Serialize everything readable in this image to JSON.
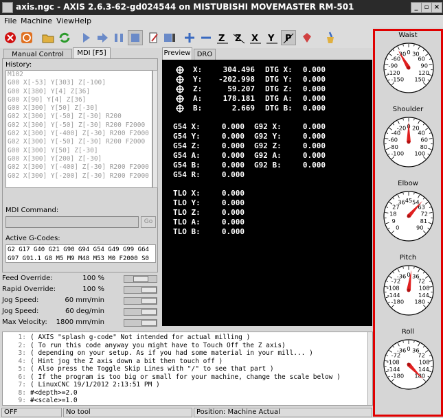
{
  "window": {
    "title": "axis.ngc - AXIS 2.6.3-62-gd024544 on MISTUBISHI MOVEMASTER RM-501",
    "icon": "app-icon",
    "buttons": [
      "_",
      "▫",
      "×"
    ]
  },
  "menu": {
    "file": "File",
    "machine": "Machine",
    "view": "View",
    "help": "Help"
  },
  "toolbar_icons": [
    "estop-icon",
    "power-icon",
    "open-file-icon",
    "reload-icon",
    "run-icon",
    "step-icon",
    "pause-icon",
    "stop-icon",
    "skip-lines-icon",
    "optional-stop-icon",
    "zoom-in-icon",
    "zoom-out-icon",
    "view-z-icon",
    "view-z2-icon",
    "view-x-icon",
    "view-y-icon",
    "view-p-icon",
    "rotate-icon",
    "clear-plot-icon"
  ],
  "left_tabs": {
    "manual": "Manual Control [F3]",
    "mdi": "MDI [F5]"
  },
  "history": {
    "label": "History:",
    "lines": [
      "M102",
      "G00 X[-53] Y[303] Z[-100]",
      "G00 X[380] Y[4] Z[36]",
      "G00 X[90] Y[4] Z[36]",
      "G00 X[300] Y[50] Z[-30]",
      "G02 X[300] Y[-50] Z[-30] R200",
      "G02 X[300] Y[-50] Z[-30] R200 F2000",
      "G02 X[300] Y[-400] Z[-30] R200 F2000",
      "G02 X[300] Y[-50] Z[-30] R200 F2000",
      "G00 X[300] Y[50] Z[-30]",
      "G00 X[300] Y[200] Z[-30]",
      "G02 X[300] Y[-400] Z[-30] R200 F2000",
      "G02 X[300] Y[-200] Z[-30] R200 F2000"
    ]
  },
  "mdi": {
    "label": "MDI Command:",
    "value": "",
    "go": "Go"
  },
  "active_gcodes": {
    "label": "Active G-Codes:",
    "line1": "G2 G17 G40 G21 G90 G94 G54 G49 G99 G64",
    "line2": "G97 G91.1 G8 M5 M9 M48 M53 M0 F2000 S0"
  },
  "overrides": [
    {
      "name": "Feed Override:",
      "value": "100 %",
      "level": 0.5
    },
    {
      "name": "Rapid Override:",
      "value": "100 %",
      "level": 1.0
    },
    {
      "name": "Jog Speed:",
      "value": "60 mm/min",
      "level": 1.0
    },
    {
      "name": "Jog Speed:",
      "value": "60 deg/min",
      "level": 1.0
    },
    {
      "name": "Max Velocity:",
      "value": "1800 mm/min",
      "level": 1.0
    }
  ],
  "view_tabs": {
    "preview": "Preview",
    "dro": "DRO"
  },
  "dro": {
    "homed_icon": "homed-icon",
    "pos": [
      {
        "axis": "X:",
        "value": "304.496",
        "dtg_label": "DTG X:",
        "dtg": "0.000"
      },
      {
        "axis": "Y:",
        "value": "-202.998",
        "dtg_label": "DTG Y:",
        "dtg": "0.000"
      },
      {
        "axis": "Z:",
        "value": "59.207",
        "dtg_label": "DTG Z:",
        "dtg": "0.000"
      },
      {
        "axis": "A:",
        "value": "178.181",
        "dtg_label": "DTG A:",
        "dtg": "0.000"
      },
      {
        "axis": "B:",
        "value": "2.669",
        "dtg_label": "DTG B:",
        "dtg": "0.000"
      }
    ],
    "g54": [
      {
        "label": "G54 X:",
        "value": "0.000",
        "g92_label": "G92 X:",
        "g92": "0.000"
      },
      {
        "label": "G54 Y:",
        "value": "0.000",
        "g92_label": "G92 Y:",
        "g92": "0.000"
      },
      {
        "label": "G54 Z:",
        "value": "0.000",
        "g92_label": "G92 Z:",
        "g92": "0.000"
      },
      {
        "label": "G54 A:",
        "value": "0.000",
        "g92_label": "G92 A:",
        "g92": "0.000"
      },
      {
        "label": "G54 B:",
        "value": "0.000",
        "g92_label": "G92 B:",
        "g92": "0.000"
      },
      {
        "label": "G54 R:",
        "value": "0.000",
        "g92_label": "",
        "g92": ""
      }
    ],
    "tlo": [
      {
        "label": "TLO X:",
        "value": "0.000"
      },
      {
        "label": "TLO Y:",
        "value": "0.000"
      },
      {
        "label": "TLO Z:",
        "value": "0.000"
      },
      {
        "label": "TLO A:",
        "value": "0.000"
      },
      {
        "label": "TLO B:",
        "value": "0.000"
      }
    ]
  },
  "gcode": [
    {
      "n": "1:",
      "text": "( AXIS \"splash g-code\" Not intended for actual milling )"
    },
    {
      "n": "2:",
      "text": "( To run this code anyway you might have to Touch Off the Z axis)"
    },
    {
      "n": "3:",
      "text": "( depending on your setup. As if you had some material in your mill... )"
    },
    {
      "n": "4:",
      "text": "( Hint jog the Z axis down a bit then touch off )"
    },
    {
      "n": "5:",
      "text": "( Also press the Toggle Skip Lines with \"/\" to see that part )"
    },
    {
      "n": "6:",
      "text": "( If the program is too big or small for your machine, change the scale below )"
    },
    {
      "n": "7:",
      "text": "( LinuxCNC 19/1/2012 2:13:51 PM )"
    },
    {
      "n": "8:",
      "text": "#<depth>=2.0"
    },
    {
      "n": "9:",
      "text": "#<scale>=1.0"
    }
  ],
  "status": {
    "state": "OFF",
    "tool": "No tool",
    "position": "Position: Machine Actual"
  },
  "gauges": [
    {
      "name": "Waist",
      "labels": [
        "-150",
        "-120",
        "-90",
        "-60",
        "-30",
        "0",
        "30",
        "60",
        "90",
        "120",
        "150"
      ],
      "value": -34
    },
    {
      "name": "Shoulder",
      "labels": [
        "-100",
        "-80",
        "-60",
        "-40",
        "-20",
        "0",
        "20",
        "40",
        "60",
        "80",
        "100"
      ],
      "value": 0
    },
    {
      "name": "Elbow",
      "labels": [
        "0",
        "9",
        "18",
        "27",
        "36",
        "45",
        "54",
        "63",
        "72",
        "81",
        "90"
      ],
      "value": 59
    },
    {
      "name": "Pitch",
      "labels": [
        "-180",
        "-144",
        "-108",
        "-72",
        "-36",
        "0",
        "36",
        "72",
        "108",
        "144",
        "180"
      ],
      "value": 10
    },
    {
      "name": "Roll",
      "labels": [
        "-180",
        "-144",
        "-108",
        "-72",
        "-36",
        "0",
        "36",
        "72",
        "108",
        "144",
        "180"
      ],
      "value": 181
    }
  ],
  "colors": {
    "accent": "#e00000",
    "needle": "#e02020",
    "dro_bg": "#000000",
    "dro_text": "#ffffff"
  }
}
